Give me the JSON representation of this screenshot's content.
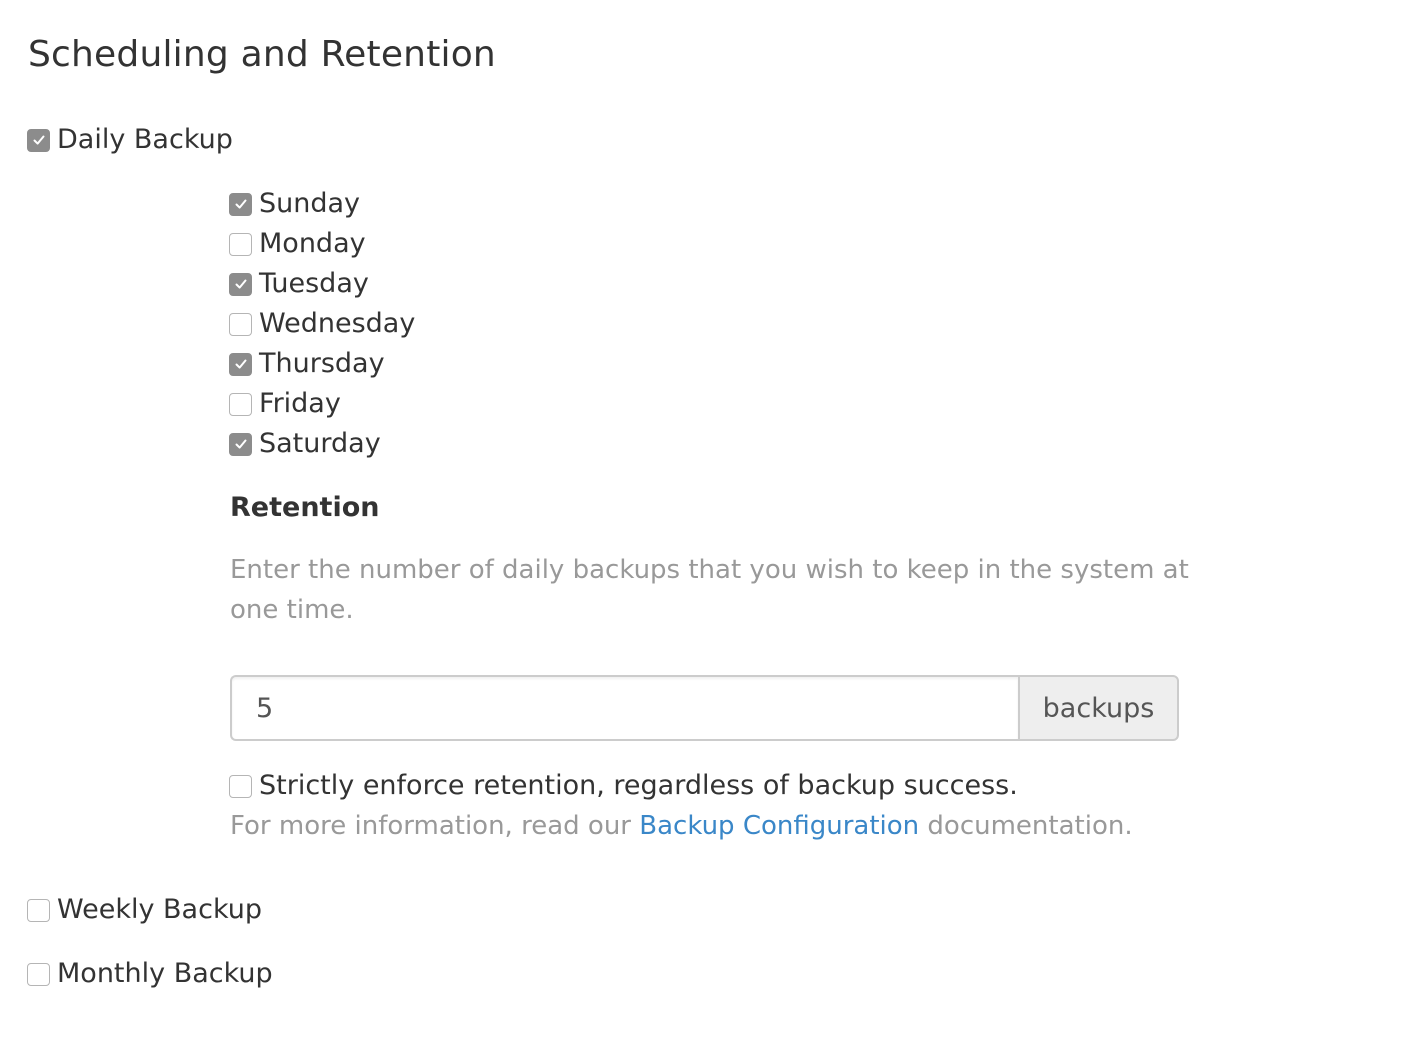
{
  "title": "Scheduling and Retention",
  "daily_backup": {
    "label": "Daily Backup",
    "checked": true,
    "days": [
      {
        "label": "Sunday",
        "checked": true
      },
      {
        "label": "Monday",
        "checked": false
      },
      {
        "label": "Tuesday",
        "checked": true
      },
      {
        "label": "Wednesday",
        "checked": false
      },
      {
        "label": "Thursday",
        "checked": true
      },
      {
        "label": "Friday",
        "checked": false
      },
      {
        "label": "Saturday",
        "checked": true
      }
    ],
    "retention": {
      "heading": "Retention",
      "help_text": "Enter the number of daily backups that you wish to keep in the system at one time.",
      "value": "5",
      "addon_label": "backups",
      "strict_enforce_label": "Strictly enforce retention, regardless of backup success.",
      "strict_enforce_checked": false,
      "info_prefix": "For more information, read our ",
      "info_link": "Backup Configuration",
      "info_suffix": " documentation."
    }
  },
  "weekly_backup": {
    "label": "Weekly Backup",
    "checked": false
  },
  "monthly_backup": {
    "label": "Monthly Backup",
    "checked": false
  },
  "colors": {
    "checkbox_checked": "#8c8c8c",
    "link": "#3a87c8",
    "muted_text": "#999999"
  }
}
